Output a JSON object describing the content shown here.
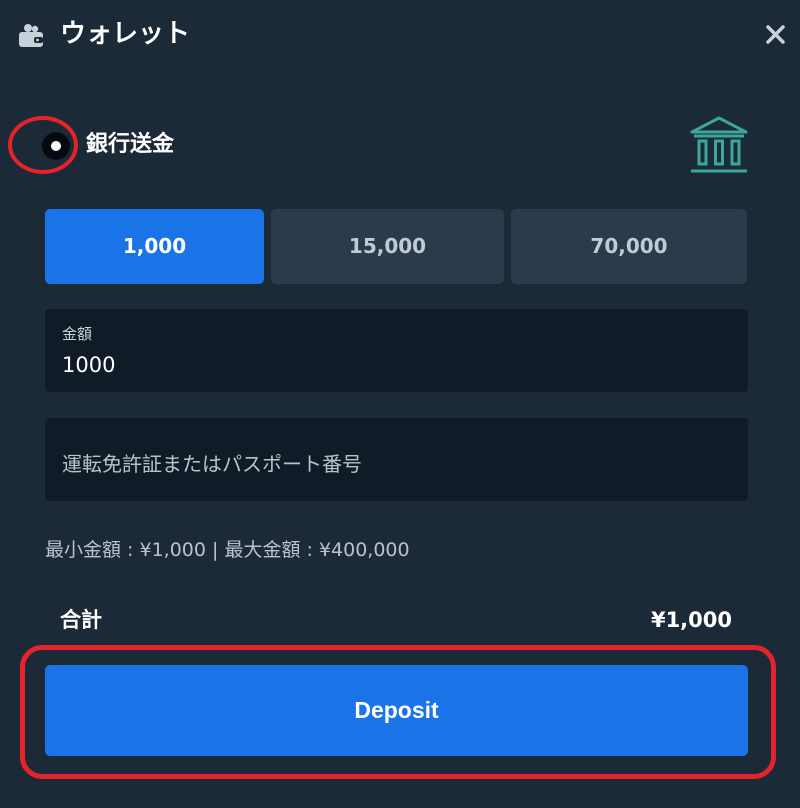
{
  "header": {
    "title": "ウォレット",
    "wallet_icon": "wallet-icon",
    "close_icon": "close-icon"
  },
  "payment_method": {
    "label": "銀行送金",
    "selected": true,
    "icon": "bank-icon",
    "icon_color": "#3aa79a"
  },
  "amount_presets": [
    {
      "label": "1,000",
      "active": true
    },
    {
      "label": "15,000",
      "active": false
    },
    {
      "label": "70,000",
      "active": false
    }
  ],
  "amount_field": {
    "label": "金額",
    "value": "1000"
  },
  "id_field": {
    "placeholder": "運転免許証またはパスポート番号"
  },
  "limits": {
    "min": "最小金額 : ¥1,000",
    "separator": "|",
    "max": "最大金額 : ¥400,000"
  },
  "total": {
    "label": "合計",
    "value": "¥1,000"
  },
  "deposit_button": {
    "label": "Deposit"
  },
  "colors": {
    "background": "#1c2a38",
    "accent": "#1a74e8",
    "highlight": "#e5232b",
    "field_bg": "#0f1c28",
    "inactive_button": "#2a3c4c"
  }
}
